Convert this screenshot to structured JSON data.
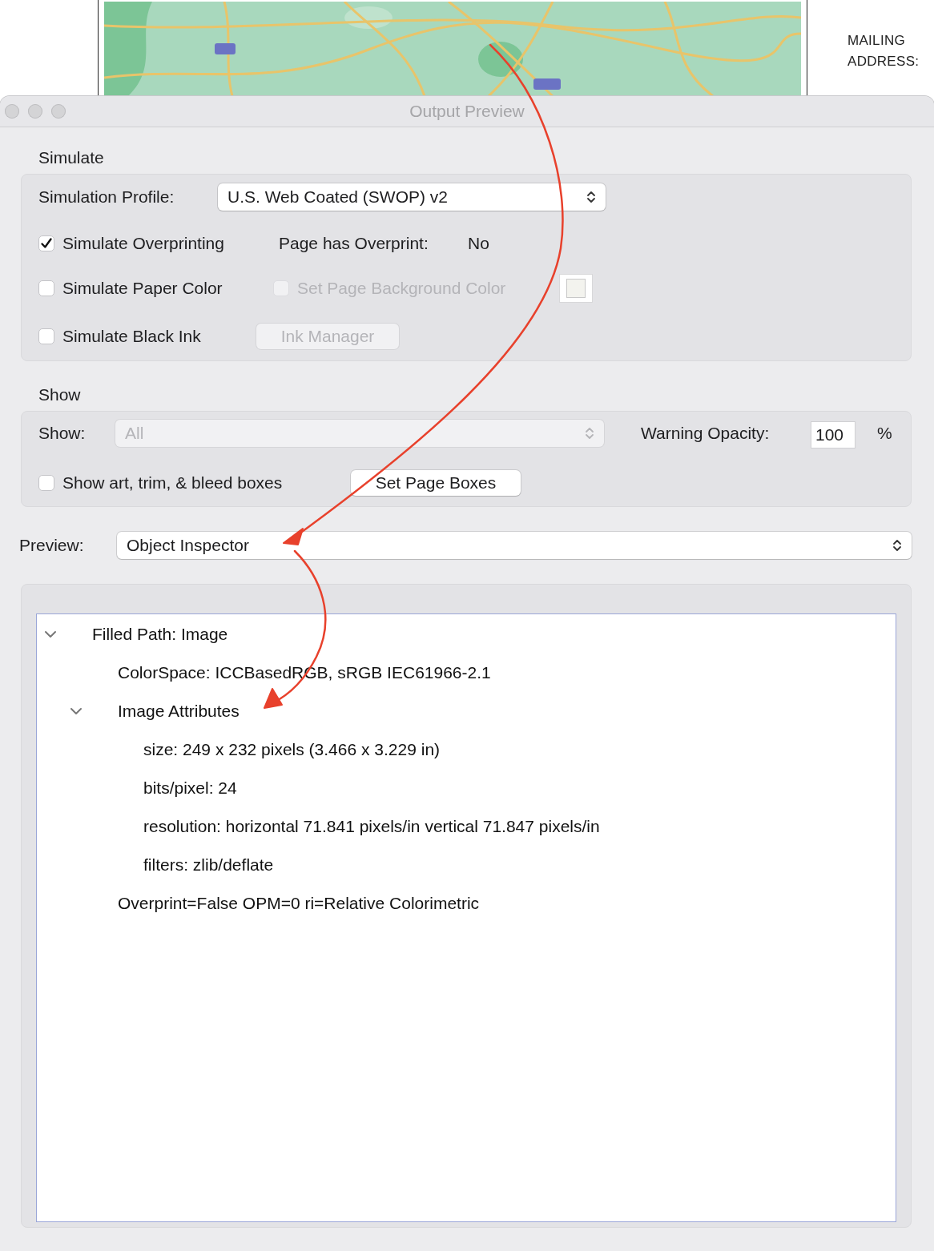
{
  "backdrop": {
    "address_label": "MAILING ADDRESS:"
  },
  "window": {
    "title": "Output Preview"
  },
  "simulate": {
    "heading": "Simulate",
    "profile": {
      "label": "Simulation Profile:",
      "value": "U.S. Web Coated (SWOP) v2"
    },
    "overprinting": {
      "label": "Simulate Overprinting",
      "checked": true
    },
    "overprint_info": {
      "label": "Page has Overprint:",
      "value": "No"
    },
    "paper_color": {
      "label": "Simulate Paper Color",
      "checked": false
    },
    "page_background": {
      "label": "Set Page Background Color",
      "checked": false,
      "disabled": true
    },
    "black_ink": {
      "label": "Simulate Black Ink",
      "checked": false
    },
    "ink_manager": {
      "label": "Ink Manager",
      "disabled": true
    }
  },
  "show": {
    "heading": "Show",
    "show_select": {
      "label": "Show:",
      "value": "All",
      "disabled": true
    },
    "warning_opacity": {
      "label": "Warning Opacity:",
      "value": "100",
      "unit": "%"
    },
    "boxes": {
      "label": "Show art, trim, & bleed boxes",
      "checked": false
    },
    "set_page_boxes": {
      "label": "Set Page Boxes",
      "disabled": false
    }
  },
  "preview": {
    "label": "Preview:",
    "value": "Object Inspector"
  },
  "inspector": {
    "tree": [
      {
        "label": "Filled Path: Image",
        "expanded": true,
        "children": [
          {
            "label": "ColorSpace: ICCBasedRGB, sRGB IEC61966-2.1"
          },
          {
            "label": "Image Attributes",
            "expanded": true,
            "children": [
              {
                "label": "size: 249 x 232 pixels (3.466 x 3.229 in)"
              },
              {
                "label": "bits/pixel: 24"
              },
              {
                "label": "resolution: horizontal 71.841 pixels/in vertical 71.847 pixels/in"
              },
              {
                "label": "filters: zlib/deflate"
              }
            ]
          },
          {
            "label": "Overprint=False OPM=0 ri=Relative Colorimetric"
          }
        ]
      }
    ]
  }
}
